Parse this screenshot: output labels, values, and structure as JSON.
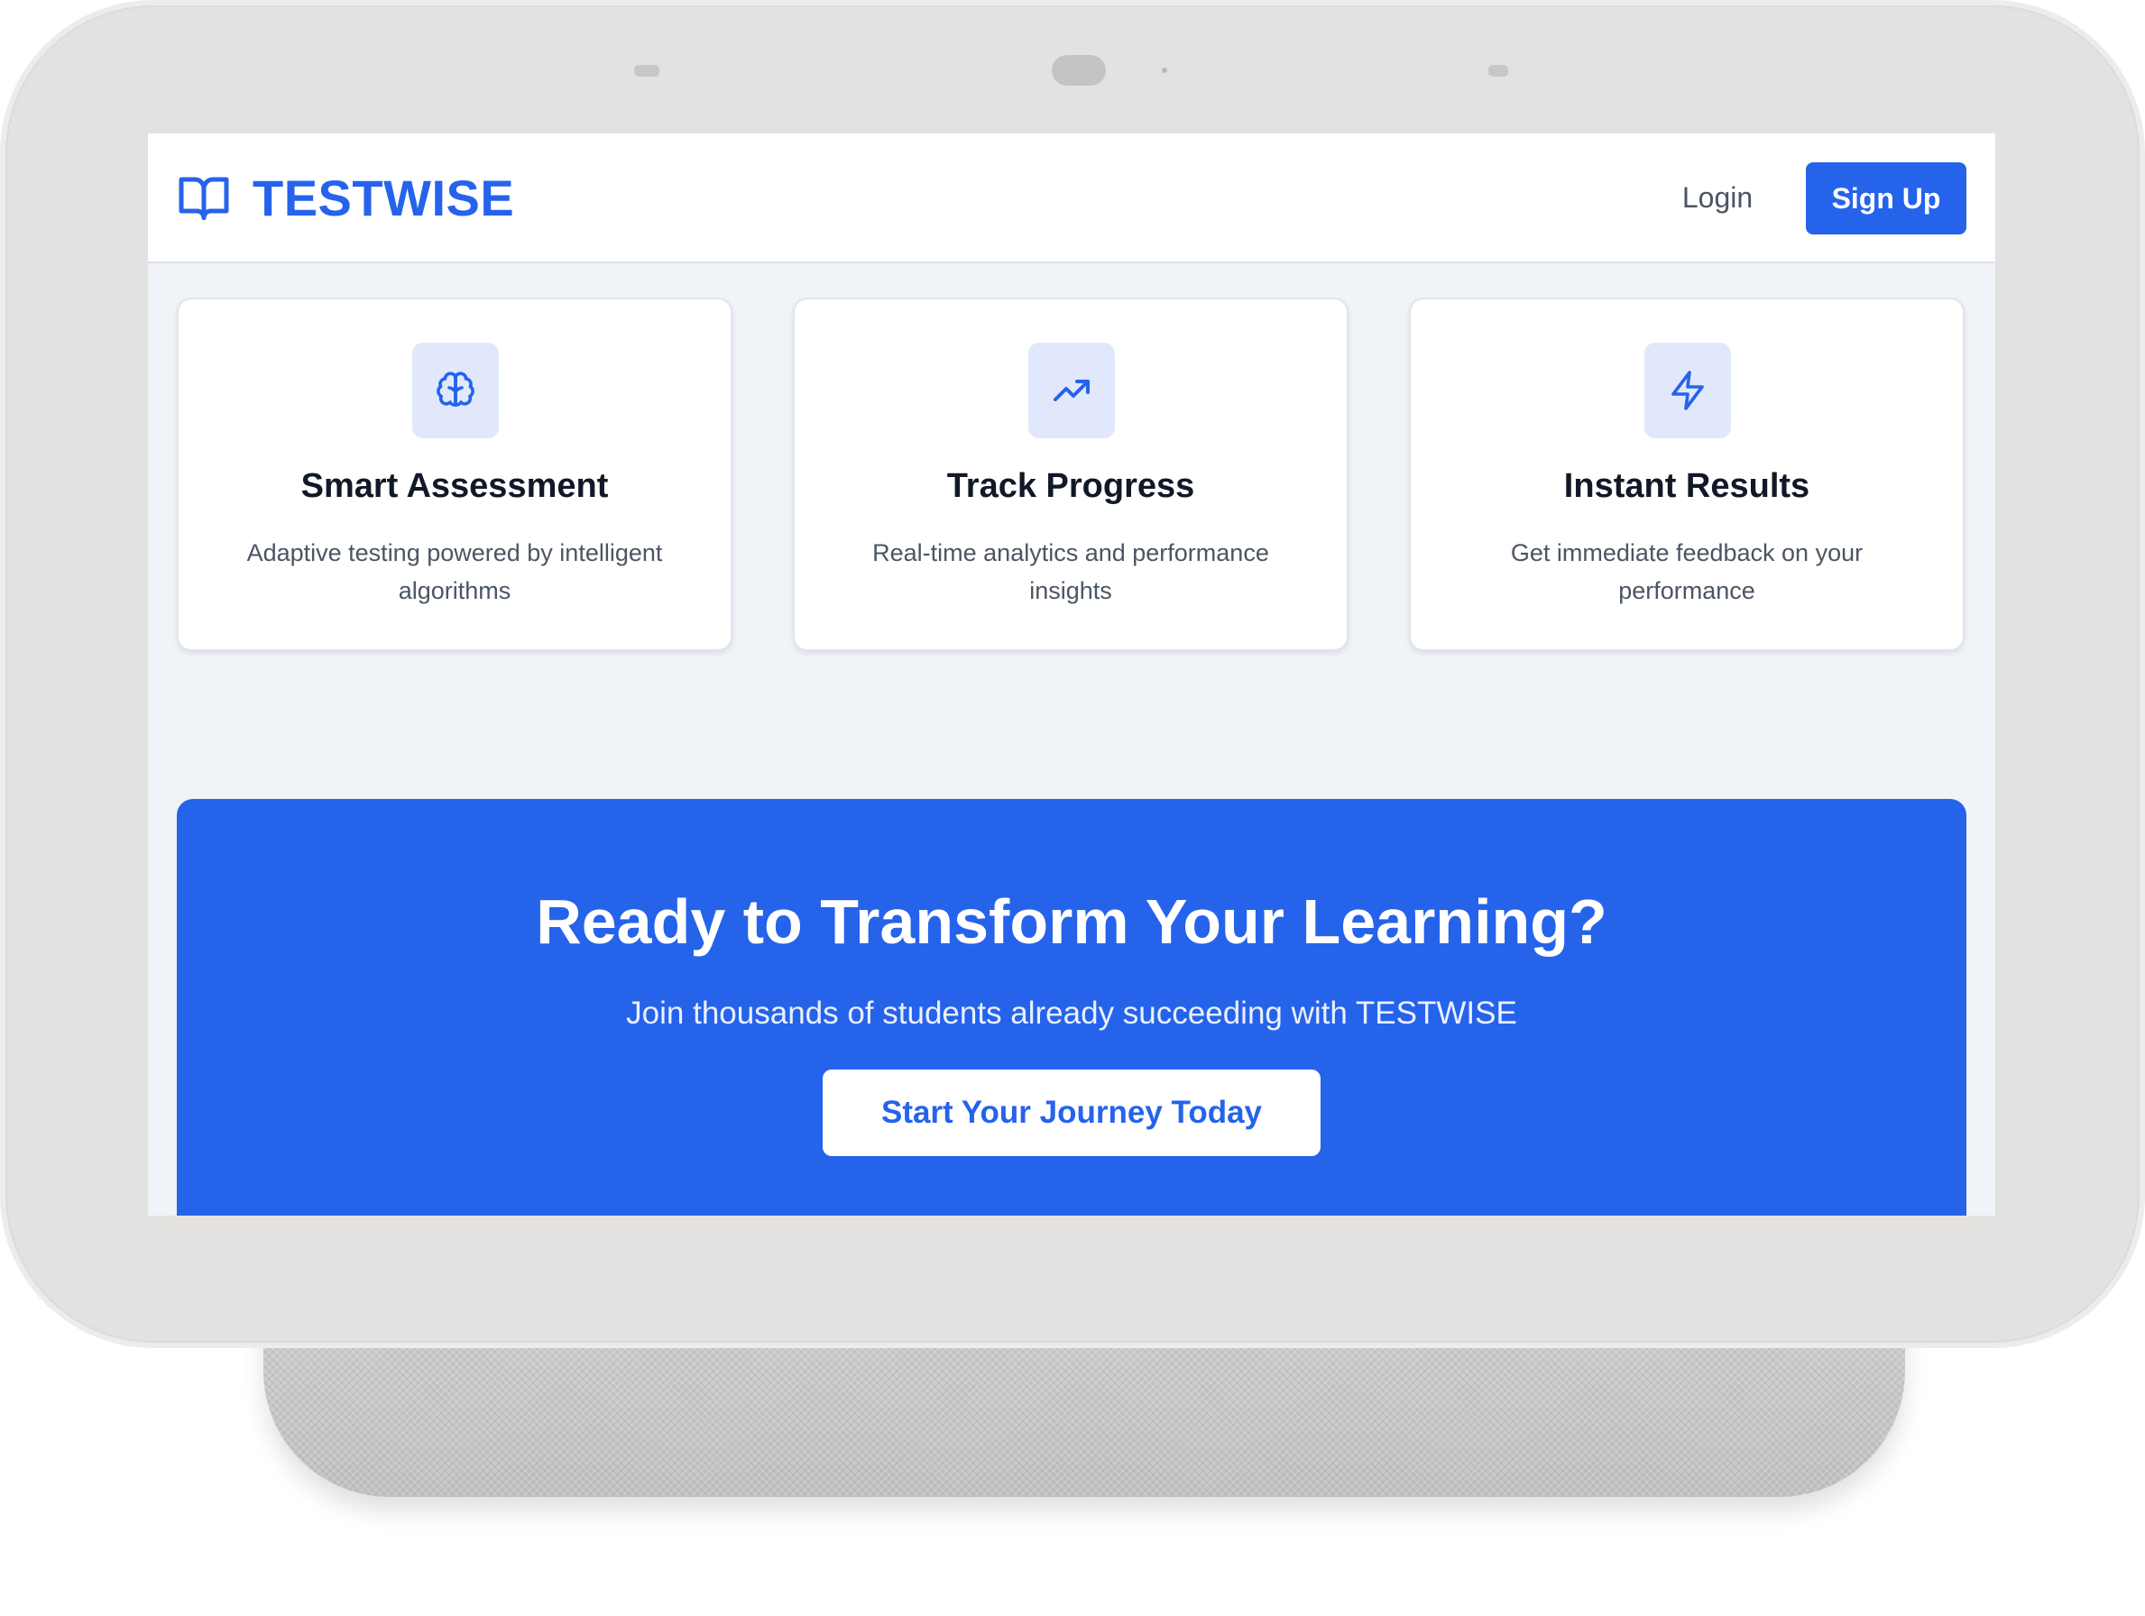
{
  "brand": {
    "name": "TESTWISE",
    "icon": "book-open-icon"
  },
  "nav": {
    "login_label": "Login",
    "signup_label": "Sign Up"
  },
  "features": [
    {
      "icon": "brain-icon",
      "title": "Smart Assessment",
      "description": "Adaptive testing powered by intelligent algorithms"
    },
    {
      "icon": "trending-up-icon",
      "title": "Track Progress",
      "description": "Real-time analytics and performance insights"
    },
    {
      "icon": "lightning-bolt-icon",
      "title": "Instant Results",
      "description": "Get immediate feedback on your performance"
    }
  ],
  "cta": {
    "title": "Ready to Transform Your Learning?",
    "subtitle": "Join thousands of students already succeeding with TESTWISE",
    "button_label": "Start Your Journey Today"
  },
  "colors": {
    "primary": "#2563eb",
    "page_background": "#f0f3f7",
    "icon_tile": "#e2e8fb",
    "heading_text": "#111827",
    "body_text": "#4b5563"
  }
}
